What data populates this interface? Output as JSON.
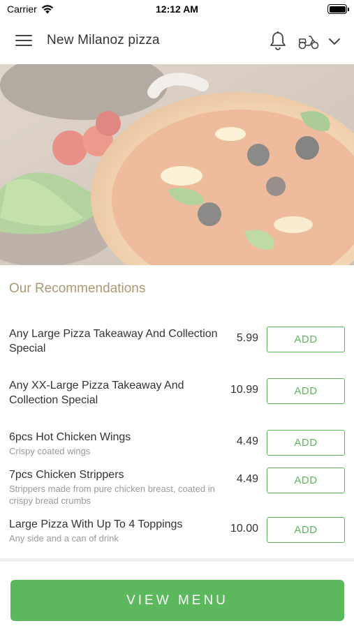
{
  "status_bar": {
    "carrier": "Carrier",
    "time": "12:12 AM"
  },
  "header": {
    "title": "New Milanoz pizza",
    "icons": [
      "menu-icon",
      "bell-icon",
      "scooter-icon",
      "chevron-down-icon"
    ]
  },
  "recommendations": {
    "title": "Our Recommendations",
    "items": [
      {
        "name": "Any Large Pizza Takeaway And Collection Special",
        "description": "",
        "price": "5.99",
        "button": "ADD"
      },
      {
        "name": "Any XX-Large Pizza Takeaway And Collection Special",
        "description": "",
        "price": "10.99",
        "button": "ADD"
      },
      {
        "name": "6pcs Hot Chicken Wings",
        "description": "Crispy coated wings",
        "price": "4.49",
        "button": "ADD"
      },
      {
        "name": "7pcs Chicken Strippers",
        "description": "Strippers made from pure chicken breast, coated in crispy bread crumbs",
        "price": "4.49",
        "button": "ADD"
      },
      {
        "name": "Large Pizza With Up To 4 Toppings",
        "description": "Any side and a can of drink",
        "price": "10.00",
        "button": "ADD"
      }
    ]
  },
  "footer": {
    "view_menu": "VIEW MENU"
  },
  "colors": {
    "accent_green": "#5cb85c",
    "section_title": "#a89a75"
  }
}
